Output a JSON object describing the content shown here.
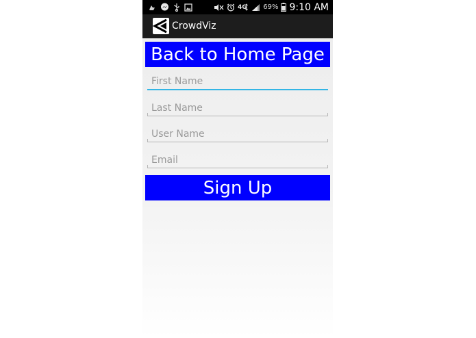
{
  "status_bar": {
    "icons_left": [
      "recycle-icon",
      "messenger-icon",
      "usb-icon",
      "image-icon"
    ],
    "icons_right": [
      "mute-icon",
      "alarm-icon",
      "4g-lte-icon",
      "signal-icon",
      "battery-icon"
    ],
    "network": "4G",
    "battery_percent": "69%",
    "time": "9:10 AM"
  },
  "action_bar": {
    "app_title": "CrowdViz",
    "logo_icon": "crowdviz-logo-icon"
  },
  "form": {
    "back_button_label": "Back to Home Page",
    "first_name_placeholder": "First Name",
    "last_name_placeholder": "Last Name",
    "user_name_placeholder": "User Name",
    "email_placeholder": "Email",
    "signup_button_label": "Sign Up"
  },
  "colors": {
    "button_blue": "#0000ff",
    "focus_underline": "#33b5e5",
    "action_bar": "#1d1d1d",
    "status_bar": "#000000"
  }
}
